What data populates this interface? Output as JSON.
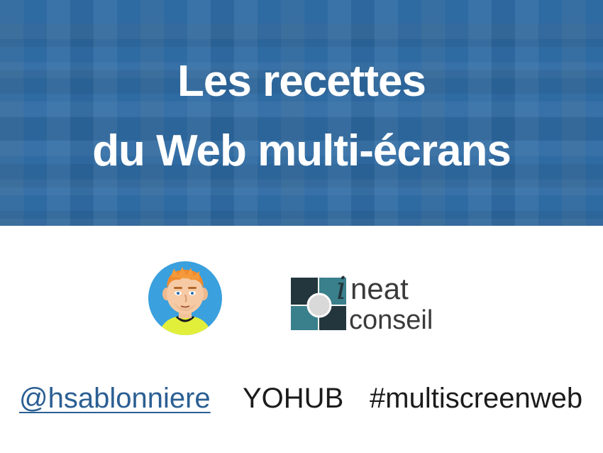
{
  "banner": {
    "title_line1": "Les recettes",
    "title_line2": "du Web multi-écrans",
    "background_color": "#2f6ba3"
  },
  "avatar": {
    "icon": "cartoon-avatar-icon"
  },
  "logo": {
    "word1": "ineat",
    "word2": "conseil",
    "colors": {
      "dark": "#23363d",
      "teal": "#3a7f8c",
      "grey": "#d0d0d0",
      "text": "#3a3a3a"
    }
  },
  "footer": {
    "handle": "@hsablonniere",
    "event": "YOHUB",
    "hashtag": "#multiscreenweb"
  }
}
